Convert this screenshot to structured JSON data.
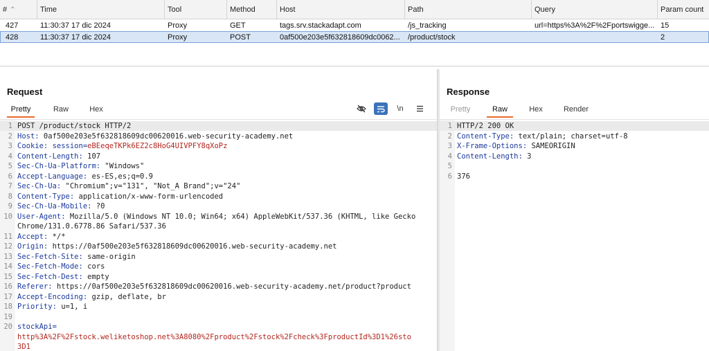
{
  "history": {
    "columns": [
      "#",
      "Time",
      "Tool",
      "Method",
      "Host",
      "Path",
      "Query",
      "Param count"
    ],
    "rows": [
      {
        "num": "427",
        "time": "11:30:37 17 dic 2024",
        "tool": "Proxy",
        "method": "GET",
        "host": "tags.srv.stackadapt.com",
        "path": "/js_tracking",
        "query": "url=https%3A%2F%2Fportswigge...",
        "params": "15"
      },
      {
        "num": "428",
        "time": "11:30:37 17 dic 2024",
        "tool": "Proxy",
        "method": "POST",
        "host": "0af500e203e5f632818609dc0062...",
        "path": "/product/stock",
        "query": "",
        "params": "2"
      }
    ]
  },
  "request": {
    "title": "Request",
    "tabs": [
      "Pretty",
      "Raw",
      "Hex"
    ],
    "active_tab": "Pretty",
    "tool_icons": [
      "eye-off-icon",
      "wrap-icon",
      "newline-icon",
      "menu-icon"
    ],
    "tool_newline_label": "\\n",
    "lines": [
      {
        "n": "1",
        "k": "",
        "v": "POST /product/stock HTTP/2"
      },
      {
        "n": "2",
        "k": "Host:",
        "v": " 0af500e203e5f632818609dc00620016.web-security-academy.net"
      },
      {
        "n": "3",
        "k": "Cookie: session=",
        "v": "eBEeqeTKPk6EZ2c8HoG4UIVPFY8qXoPz",
        "vred": true
      },
      {
        "n": "4",
        "k": "Content-Length:",
        "v": " 107"
      },
      {
        "n": "5",
        "k": "Sec-Ch-Ua-Platform:",
        "v": " \"Windows\""
      },
      {
        "n": "6",
        "k": "Accept-Language:",
        "v": " es-ES,es;q=0.9"
      },
      {
        "n": "7",
        "k": "Sec-Ch-Ua:",
        "v": " \"Chromium\";v=\"131\", \"Not_A Brand\";v=\"24\""
      },
      {
        "n": "8",
        "k": "Content-Type:",
        "v": " application/x-www-form-urlencoded"
      },
      {
        "n": "9",
        "k": "Sec-Ch-Ua-Mobile:",
        "v": " ?0"
      },
      {
        "n": "10",
        "k": "User-Agent:",
        "v": " Mozilla/5.0 (Windows NT 10.0; Win64; x64) AppleWebKit/537.36 (KHTML, like Gecko"
      },
      {
        "n": "",
        "k": "",
        "v": "Chrome/131.0.6778.86 Safari/537.36"
      },
      {
        "n": "11",
        "k": "Accept:",
        "v": " */*"
      },
      {
        "n": "12",
        "k": "Origin:",
        "v": " https://0af500e203e5f632818609dc00620016.web-security-academy.net"
      },
      {
        "n": "13",
        "k": "Sec-Fetch-Site:",
        "v": " same-origin"
      },
      {
        "n": "14",
        "k": "Sec-Fetch-Mode:",
        "v": " cors"
      },
      {
        "n": "15",
        "k": "Sec-Fetch-Dest:",
        "v": " empty"
      },
      {
        "n": "16",
        "k": "Referer:",
        "v": " https://0af500e203e5f632818609dc00620016.web-security-academy.net/product?product"
      },
      {
        "n": "17",
        "k": "Accept-Encoding:",
        "v": " gzip, deflate, br"
      },
      {
        "n": "18",
        "k": "Priority:",
        "v": " u=1, i"
      },
      {
        "n": "19",
        "k": "",
        "v": ""
      },
      {
        "n": "20",
        "k": "stockApi=",
        "v": ""
      },
      {
        "n": "",
        "k": "",
        "v": "http%3A%2F%2Fstock.weliketoshop.net%3A8080%2Fproduct%2Fstock%2Fcheck%3FproductId%3D1%26sto",
        "vred": true
      },
      {
        "n": "",
        "k": "",
        "v": "3D1",
        "vred": true
      }
    ]
  },
  "response": {
    "title": "Response",
    "tabs": [
      "Pretty",
      "Raw",
      "Hex",
      "Render"
    ],
    "active_tab": "Raw",
    "lines": [
      {
        "n": "1",
        "k": "",
        "v": "HTTP/2 200 OK"
      },
      {
        "n": "2",
        "k": "Content-Type:",
        "v": " text/plain; charset=utf-8"
      },
      {
        "n": "3",
        "k": "X-Frame-Options:",
        "v": " SAMEORIGIN"
      },
      {
        "n": "4",
        "k": "Content-Length:",
        "v": " 3"
      },
      {
        "n": "5",
        "k": "",
        "v": ""
      },
      {
        "n": "6",
        "k": "",
        "v": "376"
      }
    ]
  },
  "colors": {
    "accent": "#e8692b",
    "selected_row": "#d9e6f5",
    "header_key": "#1b3a9c",
    "value_red": "#b3261e"
  }
}
